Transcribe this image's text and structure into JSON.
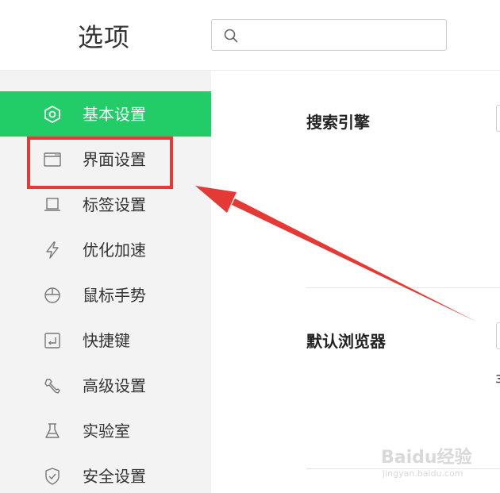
{
  "header": {
    "title": "选项",
    "search": {
      "value": "",
      "placeholder": ""
    }
  },
  "sidebar": {
    "items": [
      {
        "label": "基本设置",
        "icon": "hexagon-gear-icon",
        "active": true
      },
      {
        "label": "界面设置",
        "icon": "window-icon",
        "active": false
      },
      {
        "label": "标签设置",
        "icon": "tab-icon",
        "active": false
      },
      {
        "label": "优化加速",
        "icon": "lightning-icon",
        "active": false
      },
      {
        "label": "鼠标手势",
        "icon": "mouse-icon",
        "active": false
      },
      {
        "label": "快捷键",
        "icon": "enter-key-icon",
        "active": false
      },
      {
        "label": "高级设置",
        "icon": "wrench-icon",
        "active": false
      },
      {
        "label": "实验室",
        "icon": "flask-icon",
        "active": false
      },
      {
        "label": "安全设置",
        "icon": "shield-icon",
        "active": false
      }
    ]
  },
  "main": {
    "sections": [
      {
        "label": "搜索引擎"
      },
      {
        "label": "默认浏览器"
      }
    ],
    "truncated_char": "з"
  },
  "watermark": {
    "text": "Baidu经验",
    "sub": "jingyan.baidu.com"
  },
  "colors": {
    "accent": "#22cc66",
    "annotation": "#e53935",
    "sidebar_bg": "#f3f3f3"
  }
}
